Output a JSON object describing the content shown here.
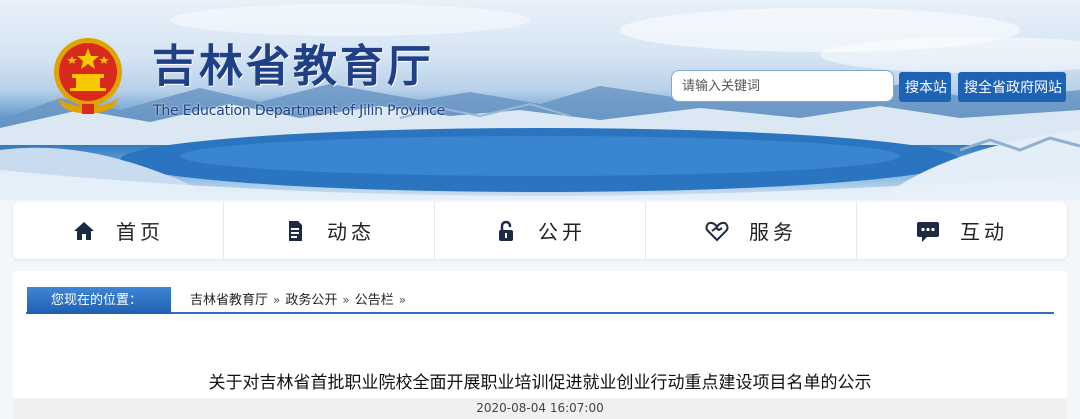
{
  "header": {
    "title": "吉林省教育厅",
    "subtitle": "The Education Department of Jilin Province",
    "emblem_icon": "national-emblem-icon"
  },
  "search": {
    "placeholder": "请输入关键词",
    "button_site": "搜本站",
    "button_gov": "搜全省政府网站"
  },
  "nav": {
    "items": [
      {
        "label": "首页",
        "icon": "home-icon"
      },
      {
        "label": "动态",
        "icon": "document-icon"
      },
      {
        "label": "公开",
        "icon": "lock-icon"
      },
      {
        "label": "服务",
        "icon": "heart-hands-icon"
      },
      {
        "label": "互动",
        "icon": "chat-icon"
      }
    ]
  },
  "location": {
    "label": "您现在的位置：",
    "crumbs": [
      "吉林省教育厅",
      "政务公开",
      "公告栏"
    ],
    "separator": "»"
  },
  "article": {
    "title": "关于对吉林省首批职业院校全面开展职业培训促进就业创业行动重点建设项目名单的公示",
    "date": "2020-08-04 16:07:00"
  },
  "colors": {
    "brand_blue": "#1f3f86",
    "button_blue": "#1d62b5",
    "bar_blue": "#2f6fc0"
  }
}
